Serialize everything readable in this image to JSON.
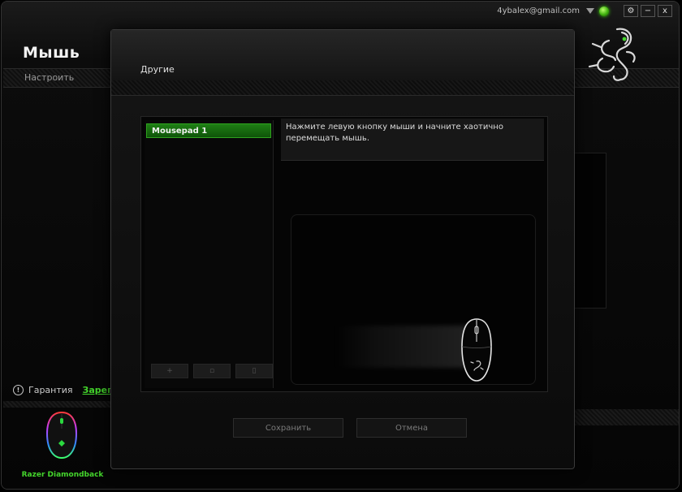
{
  "titlebar": {
    "account_email": "4ybalex@gmail.com",
    "settings_symbol": "⚙",
    "minimize_symbol": "−",
    "close_symbol": "x"
  },
  "page": {
    "title": "Мышь",
    "subnav_item": "Настроить"
  },
  "sidebar": {
    "warranty_label": "Гарантия",
    "register_link": "Зарегис",
    "device_name": "Razer Diamondback"
  },
  "dialog": {
    "title": "Другие",
    "mousepads": [
      "Mousepad 1"
    ],
    "list_tools": [
      "+",
      "▫",
      "▯"
    ],
    "instruction": "Нажмите левую кнопку мыши и начните хаотично перемещать мышь.",
    "save_button": "Сохранить",
    "cancel_button": "Отмена"
  },
  "colors": {
    "accent": "#44d62c",
    "selected_item": "#1f7f14"
  },
  "icons": {
    "logo": "razer-logo",
    "status": "status-orb-icon",
    "info": "info-icon"
  }
}
